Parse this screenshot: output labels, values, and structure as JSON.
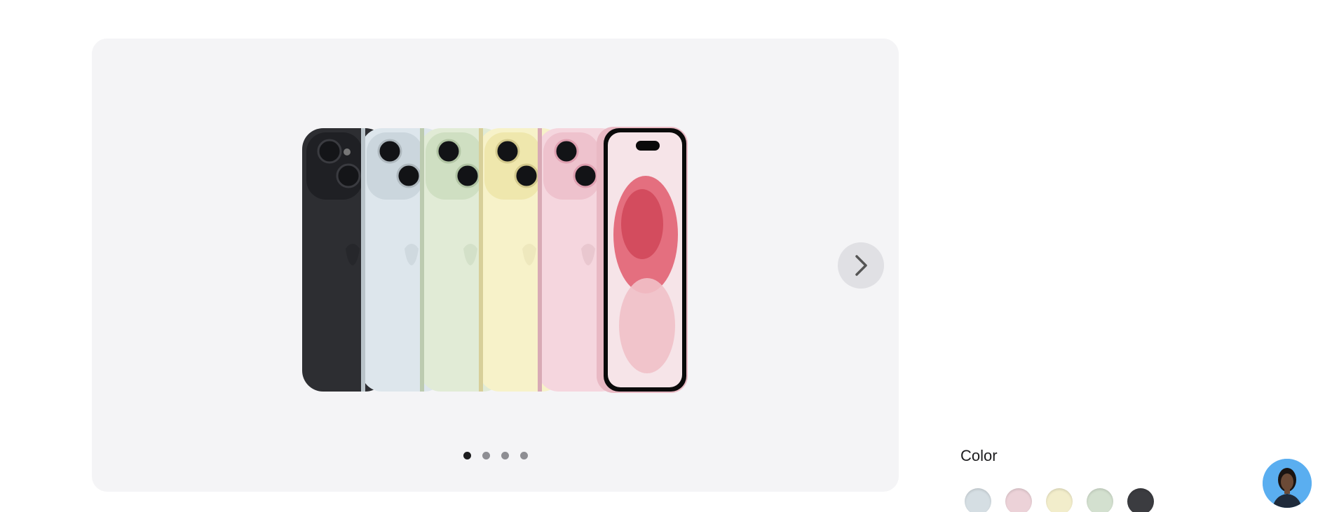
{
  "gallery": {
    "product_image": "iphone-colors-lineup",
    "product_colors": [
      "#2d2e32",
      "#dde6ec",
      "#e1ebd6",
      "#f7f2c9",
      "#f5d6de",
      "#f5d6de"
    ],
    "next_icon": "chevron-right-icon",
    "slides_total": 4,
    "active_slide": 1
  },
  "color_section": {
    "title": "Color",
    "swatches": [
      {
        "name": "blue",
        "color": "#d5dee3"
      },
      {
        "name": "pink",
        "color": "#ecd2d8"
      },
      {
        "name": "yellow",
        "color": "#f2edcb"
      },
      {
        "name": "green",
        "color": "#d3e0cf"
      },
      {
        "name": "black",
        "color": "#3b3c40"
      }
    ]
  },
  "chat_avatar": {
    "icon": "specialist-avatar-icon"
  }
}
